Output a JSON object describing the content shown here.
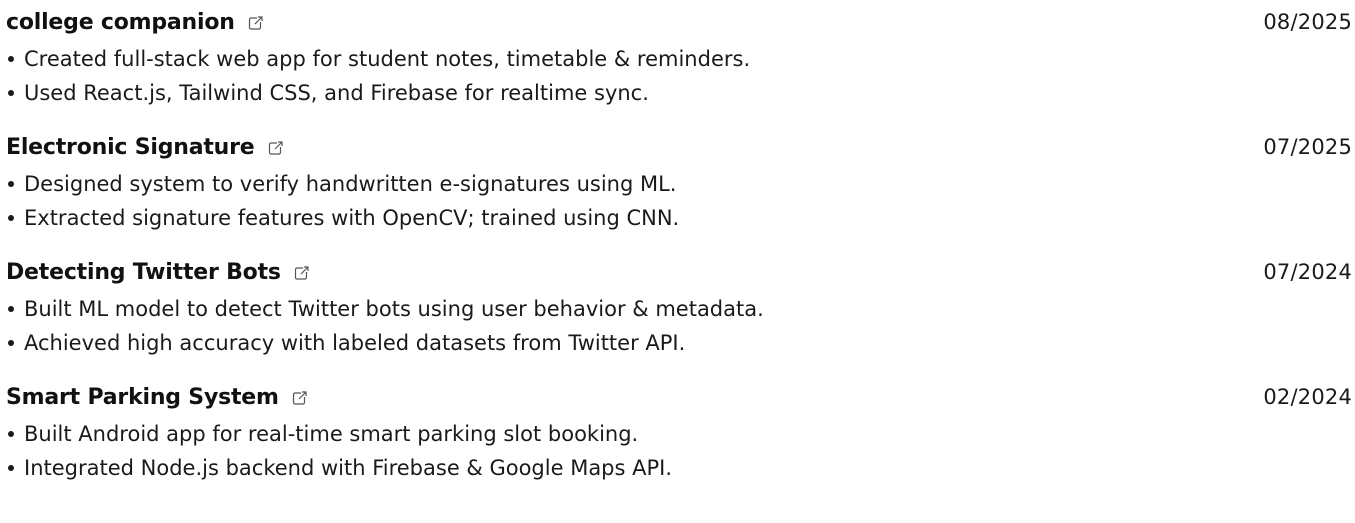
{
  "projects": [
    {
      "title": "college companion",
      "date": "08/2025",
      "bullets": [
        "Created full-stack web app for student notes, timetable & reminders.",
        "Used React.js, Tailwind CSS, and Firebase for realtime sync."
      ]
    },
    {
      "title": "Electronic Signature",
      "date": "07/2025",
      "bullets": [
        "Designed system to verify handwritten e-signatures using ML.",
        "Extracted signature features with OpenCV; trained using CNN."
      ]
    },
    {
      "title": "Detecting Twitter Bots",
      "date": "07/2024",
      "bullets": [
        "Built ML model to detect Twitter bots using user behavior & metadata.",
        "Achieved high accuracy with labeled datasets from Twitter API."
      ]
    },
    {
      "title": "Smart Parking System",
      "date": "02/2024",
      "bullets": [
        "Built Android app for real-time smart parking slot booking.",
        "Integrated Node.js backend with Firebase & Google Maps API."
      ]
    }
  ],
  "icons": {
    "link": "external-link-icon"
  },
  "colors": {
    "text": "#1a1a1a",
    "icon": "#555555"
  }
}
